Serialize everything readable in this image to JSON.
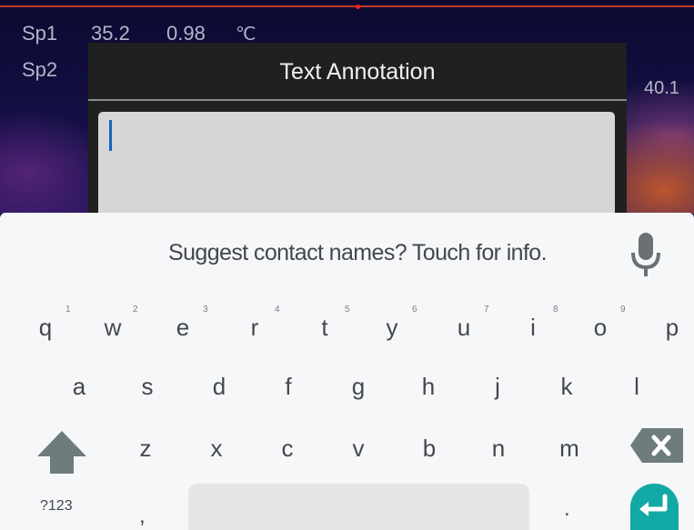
{
  "overlay": {
    "sp1_label": "Sp1",
    "sp1_temperature": "35.2",
    "sp1_emissivity": "0.98",
    "sp1_unit": "℃",
    "sp2_label": "Sp2",
    "right_temperature": "40.1"
  },
  "dialog": {
    "title": "Text Annotation",
    "input_value": ""
  },
  "keyboard": {
    "suggestion": "Suggest contact names? Touch for info.",
    "row1": [
      {
        "key": "q",
        "hint": "1"
      },
      {
        "key": "w",
        "hint": "2"
      },
      {
        "key": "e",
        "hint": "3"
      },
      {
        "key": "r",
        "hint": "4"
      },
      {
        "key": "t",
        "hint": "5"
      },
      {
        "key": "y",
        "hint": "6"
      },
      {
        "key": "u",
        "hint": "7"
      },
      {
        "key": "i",
        "hint": "8"
      },
      {
        "key": "o",
        "hint": "9"
      },
      {
        "key": "p",
        "hint": ""
      }
    ],
    "row2": [
      "a",
      "s",
      "d",
      "f",
      "g",
      "h",
      "j",
      "k",
      "l"
    ],
    "row3": [
      "z",
      "x",
      "c",
      "v",
      "b",
      "n",
      "m"
    ],
    "symbols_label": "?123",
    "comma_label": ",",
    "period_label": ".",
    "colors": {
      "enter": "#11a8a5",
      "shift": "#6f7c7e",
      "backspace": "#6f7c7e"
    }
  }
}
